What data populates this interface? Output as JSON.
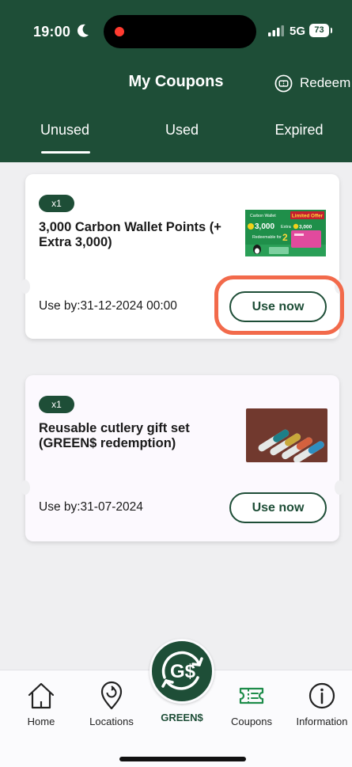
{
  "status": {
    "time": "19:00",
    "network": "5G",
    "battery": "73"
  },
  "header": {
    "title": "My Coupons",
    "redeem_label": "Redeem"
  },
  "tabs": [
    {
      "label": "Unused",
      "active": true
    },
    {
      "label": "Used",
      "active": false
    },
    {
      "label": "Expired",
      "active": false
    }
  ],
  "coupons": [
    {
      "qty": "x1",
      "title": "3,000 Carbon Wallet Points (+ Extra 3,000)",
      "use_by": "Use by:31-12-2024 00:00",
      "button": "Use now",
      "thumb": {
        "brand": "Carbon Wallet",
        "badge": "Limited Offer",
        "points": "3,000",
        "extra_label": "Extra",
        "extra_points": "3,000",
        "redeemable_text": "Redeemable for",
        "big_number": "2"
      }
    },
    {
      "qty": "x1",
      "title": "Reusable cutlery gift set (GREEN$ redemption)",
      "use_by": "Use by:31-07-2024",
      "button": "Use now"
    }
  ],
  "nav": [
    {
      "label": "Home",
      "icon": "home-icon"
    },
    {
      "label": "Locations",
      "icon": "location-pin-icon"
    },
    {
      "label": "GREEN$",
      "icon": "green-dollar-icon"
    },
    {
      "label": "Coupons",
      "icon": "ticket-icon"
    },
    {
      "label": "Information",
      "icon": "info-icon"
    }
  ],
  "colors": {
    "brand": "#1e4e37",
    "highlight": "#f26a4b",
    "background": "#efeff1"
  }
}
